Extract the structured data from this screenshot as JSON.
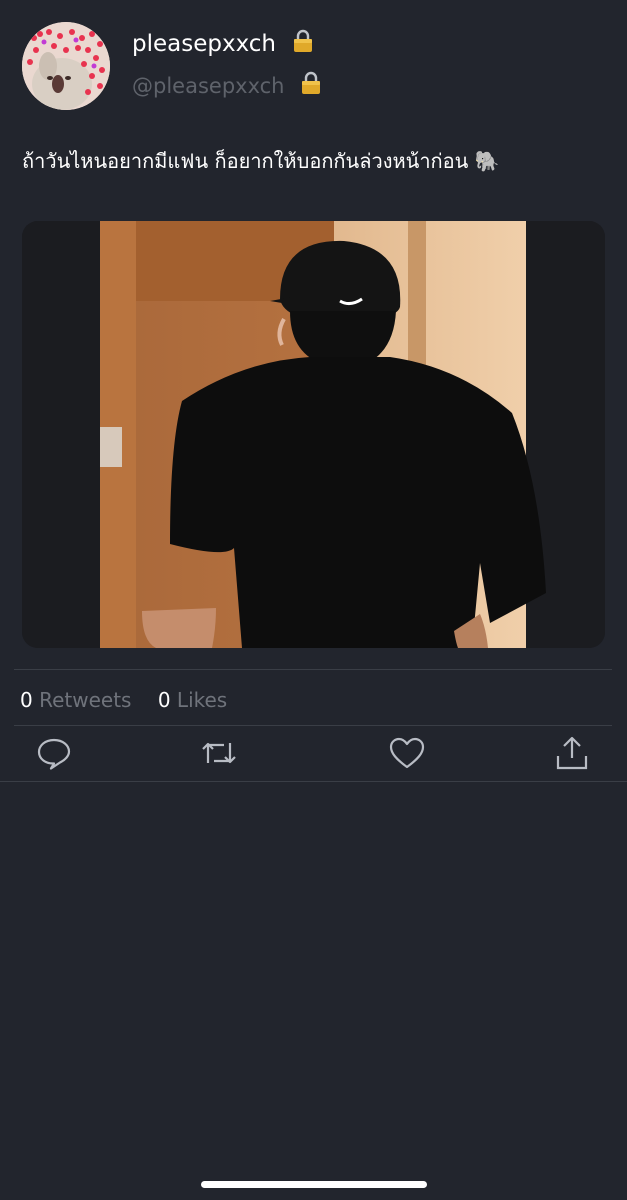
{
  "profile": {
    "display_name": "pleasepxxch",
    "handle": "@pleasepxxch",
    "avatar_icon": "cat-with-hearts-avatar",
    "lock_icon": "lock-icon"
  },
  "tweet": {
    "text": "ถ้าวันไหนอยากมีแฟน ก็อยากให้บอกกันล่วงหน้าก่อน 🐘",
    "media_description_icon": "photo"
  },
  "stats": {
    "retweets_count": "0",
    "retweets_label": "Retweets",
    "likes_count": "0",
    "likes_label": "Likes"
  },
  "actions": {
    "reply_icon": "reply-icon",
    "retweet_icon": "retweet-icon",
    "like_icon": "heart-icon",
    "share_icon": "share-icon"
  },
  "colors": {
    "background": "#22252d",
    "primary_text": "#ffffff",
    "secondary_text": "#6f737b",
    "icon": "#b8bcc4",
    "divider": "#3a3e46"
  }
}
